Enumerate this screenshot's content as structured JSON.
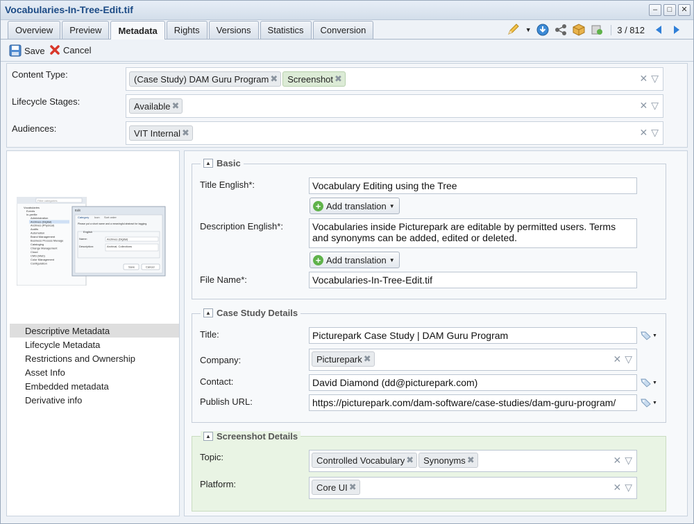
{
  "window": {
    "title": "Vocabularies-In-Tree-Edit.tif"
  },
  "tabs": [
    "Overview",
    "Preview",
    "Metadata",
    "Rights",
    "Versions",
    "Statistics",
    "Conversion"
  ],
  "active_tab": "Metadata",
  "pager": "3 / 812",
  "toolbar": {
    "save": "Save",
    "cancel": "Cancel"
  },
  "facets": {
    "content_type": {
      "label": "Content Type:",
      "chips": [
        "(Case Study) DAM Guru Program",
        "Screenshot"
      ]
    },
    "lifecycle": {
      "label": "Lifecycle Stages:",
      "chips": [
        "Available"
      ]
    },
    "audiences": {
      "label": "Audiences:",
      "chips": [
        "VIT Internal"
      ]
    }
  },
  "nav": [
    "Descriptive Metadata",
    "Lifecycle Metadata",
    "Restrictions and Ownership",
    "Asset Info",
    "Embedded metadata",
    "Derivative info"
  ],
  "basic": {
    "heading": "Basic",
    "title_label": "Title English*:",
    "title_value": "Vocabulary Editing using the Tree",
    "add_translation": "Add translation",
    "desc_label": "Description English*:",
    "desc_value": "Vocabularies inside Picturepark are editable by permitted users. Terms and synonyms can be added, edited or deleted.",
    "file_label": "File Name*:",
    "file_value": "Vocabularies-In-Tree-Edit.tif"
  },
  "case_study": {
    "heading": "Case Study Details",
    "title_label": "Title:",
    "title_value": "Picturepark Case Study | DAM Guru Program",
    "company_label": "Company:",
    "company_chip": "Picturepark",
    "contact_label": "Contact:",
    "contact_value": "David Diamond (dd@picturepark.com)",
    "url_label": "Publish URL:",
    "url_value": "https://picturepark.com/dam-software/case-studies/dam-guru-program/"
  },
  "screenshot": {
    "heading": "Screenshot Details",
    "topic_label": "Topic:",
    "topic_chips": [
      "Controlled Vocabulary",
      "Synonyms"
    ],
    "platform_label": "Platform:",
    "platform_chips": [
      "Core UI"
    ]
  },
  "thumbnail": {
    "dialog_title": "Edit",
    "filter_placeholder": "Filter categories",
    "tree_items": [
      "Vocabularies",
      "Events",
      "In-perfile",
      "Administration",
      "Archives (Digital)",
      "Archives (Physical)",
      "Audits",
      "Automation",
      "Brand Management",
      "Business Process Manage",
      "Cataloging",
      "Change Management",
      "Cloud",
      "CMS (Web)",
      "Color Management",
      "Configuration"
    ],
    "dialog_tabs": [
      "Category",
      "Icon",
      "Sort order"
    ],
    "dialog_text": "Please put a short name and a meaningful abstract for tagging.",
    "dialog_lang": "English",
    "dialog_name_label": "Name:",
    "dialog_name_value": "Archives (Digital)",
    "dialog_desc_label": "Description:",
    "dialog_desc_value": "Archival, Collections",
    "dialog_save": "Save",
    "dialog_cancel": "Cancel"
  },
  "colors": {
    "accent": "#1b4a85",
    "green_section": "#e9f4e4",
    "chip_green": "#dcebd6"
  }
}
